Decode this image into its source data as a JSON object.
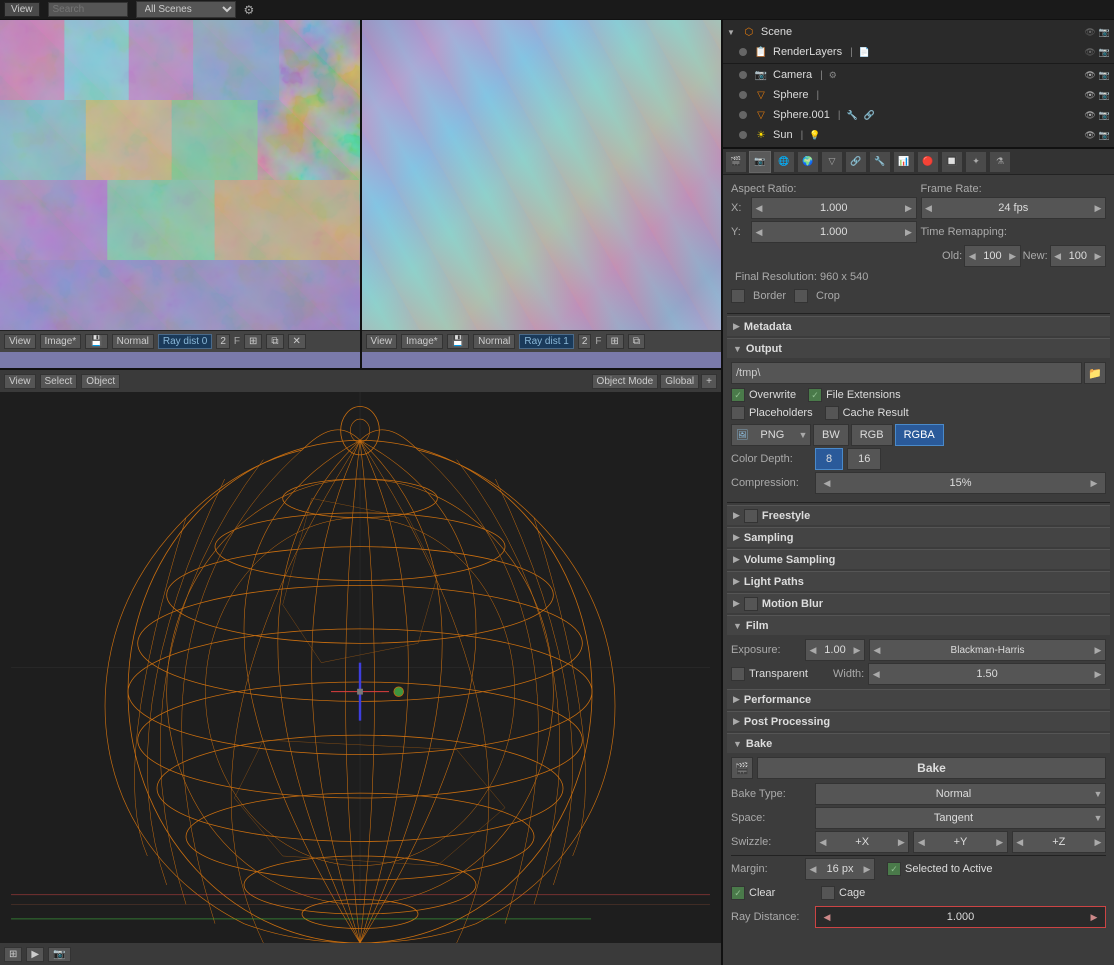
{
  "topbar": {
    "view_label": "View",
    "search_label": "Search",
    "scene_label": "All Scenes",
    "icon_label": "⚙"
  },
  "outliner": {
    "title": "Scene",
    "items": [
      {
        "name": "RenderLayers",
        "icon": "📋",
        "type": "renderlayers"
      },
      {
        "name": "Camera",
        "icon": "📷",
        "type": "camera"
      },
      {
        "name": "Sphere",
        "icon": "🔶",
        "type": "mesh"
      },
      {
        "name": "Sphere.001",
        "icon": "🔶",
        "type": "mesh"
      },
      {
        "name": "Sun",
        "icon": "☀",
        "type": "light"
      }
    ]
  },
  "image_viewers": [
    {
      "mode": "Normal",
      "raydist": "Ray dist 0",
      "num": "2",
      "flag": "F"
    },
    {
      "mode": "Normal",
      "raydist": "Ray dist 1",
      "num": "2",
      "flag": "F"
    }
  ],
  "render_props": {
    "aspect_ratio_label": "Aspect Ratio:",
    "frame_rate_label": "Frame Rate:",
    "x_label": "X:",
    "x_value": "1.000",
    "y_label": "Y:",
    "y_value": "1.000",
    "fps_value": "24 fps",
    "time_remap_label": "Time Remapping:",
    "old_label": "Old:",
    "old_value": "100",
    "new_label": "New:",
    "new_value": "100",
    "final_res": "Final Resolution: 960 x 540",
    "border_label": "Border",
    "crop_label": "Crop"
  },
  "sections": {
    "metadata": "Metadata",
    "output": "Output",
    "freestyle": "Freestyle",
    "sampling": "Sampling",
    "volume_sampling": "Volume Sampling",
    "light_paths": "Light Paths",
    "motion_blur": "Motion Blur",
    "film": "Film",
    "performance": "Performance",
    "post_processing": "Post Processing",
    "bake": "Bake"
  },
  "output": {
    "path": "/tmp\\",
    "overwrite_label": "Overwrite",
    "file_ext_label": "File Extensions",
    "placeholders_label": "Placeholders",
    "cache_result_label": "Cache Result",
    "format": "PNG",
    "bw_label": "BW",
    "rgb_label": "RGB",
    "rgba_label": "RGBA",
    "color_depth_label": "Color Depth:",
    "depth_8": "8",
    "depth_16": "16",
    "compression_label": "Compression:",
    "compression_value": "15%"
  },
  "film": {
    "exposure_label": "Exposure:",
    "exposure_value": "1.00",
    "filter_label": "Blackman-Harris",
    "transparent_label": "Transparent",
    "width_label": "Width:",
    "width_value": "1.50"
  },
  "bake": {
    "bake_button": "Bake",
    "bake_type_label": "Bake Type:",
    "bake_type_value": "Normal",
    "space_label": "Space:",
    "space_value": "Tangent",
    "swizzle_label": "Swizzle:",
    "swizzle_x": "+X",
    "swizzle_y": "+Y",
    "swizzle_z": "+Z",
    "margin_label": "Margin:",
    "margin_value": "16 px",
    "selected_to_active_label": "Selected to Active",
    "clear_label": "Clear",
    "cage_label": "Cage",
    "ray_dist_label": "Ray Distance:",
    "ray_dist_value": "1.000"
  }
}
